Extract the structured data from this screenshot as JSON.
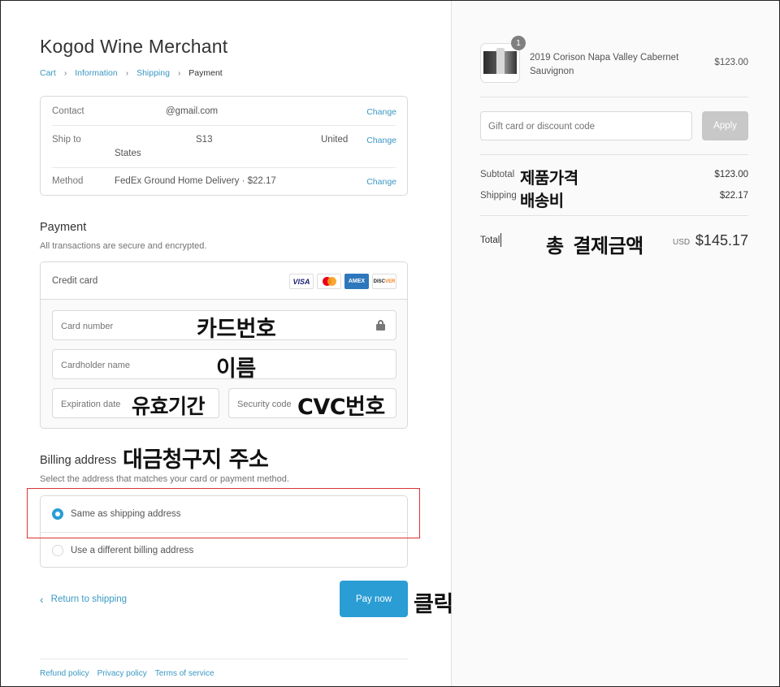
{
  "shop": {
    "title": "Kogod Wine Merchant"
  },
  "breadcrumb": {
    "items": [
      "Cart",
      "Information",
      "Shipping"
    ],
    "current": "Payment"
  },
  "review": {
    "contact_label": "Contact",
    "contact_value": "@gmail.com",
    "shipto_label": "Ship to",
    "shipto_value1": "S13",
    "shipto_value2": "United",
    "shipto_value3": "States",
    "method_label": "Method",
    "method_value": "FedEx Ground Home Delivery · $22.17",
    "change": "Change"
  },
  "payment": {
    "title": "Payment",
    "subtitle": "All transactions are secure and encrypted.",
    "method_label": "Credit card",
    "logos": {
      "visa": "VISA",
      "amex": "AMEX",
      "discover_a": "DISC",
      "discover_b": "VER"
    },
    "card_number_ph": "Card number",
    "cardholder_ph": "Cardholder name",
    "expiration_ph": "Expiration date",
    "security_ph": "Security code"
  },
  "billing": {
    "title": "Billing address",
    "subtitle": "Select the address that matches your card or payment method.",
    "option_same": "Same as shipping address",
    "option_different": "Use a different billing address"
  },
  "actions": {
    "return": "Return to shipping",
    "pay": "Pay now"
  },
  "footer": {
    "links": [
      "Refund policy",
      "Privacy policy",
      "Terms of service"
    ]
  },
  "order": {
    "quantity": "1",
    "product_name": "2019 Corison Napa Valley Cabernet Sauvignon",
    "product_price": "$123.00",
    "discount_ph": "Gift card or discount code",
    "apply": "Apply",
    "subtotal_label": "Subtotal",
    "subtotal_value": "$123.00",
    "shipping_label": "Shipping",
    "shipping_value": "$22.17",
    "total_label": "Total",
    "currency": "USD",
    "total_value": "$145.17"
  },
  "annotations": {
    "card_number": "카드번호",
    "name": "이름",
    "expiry": "유효기간",
    "cvc": "CVC번호",
    "billing": "대금청구지 주소",
    "click": "클릭",
    "product_price": "제품가격",
    "shipping": "배송비",
    "total": "총 결제금액"
  },
  "colors": {
    "accent": "#2a9dd4",
    "link": "#3a98c2",
    "highlight": "#dd3333"
  }
}
